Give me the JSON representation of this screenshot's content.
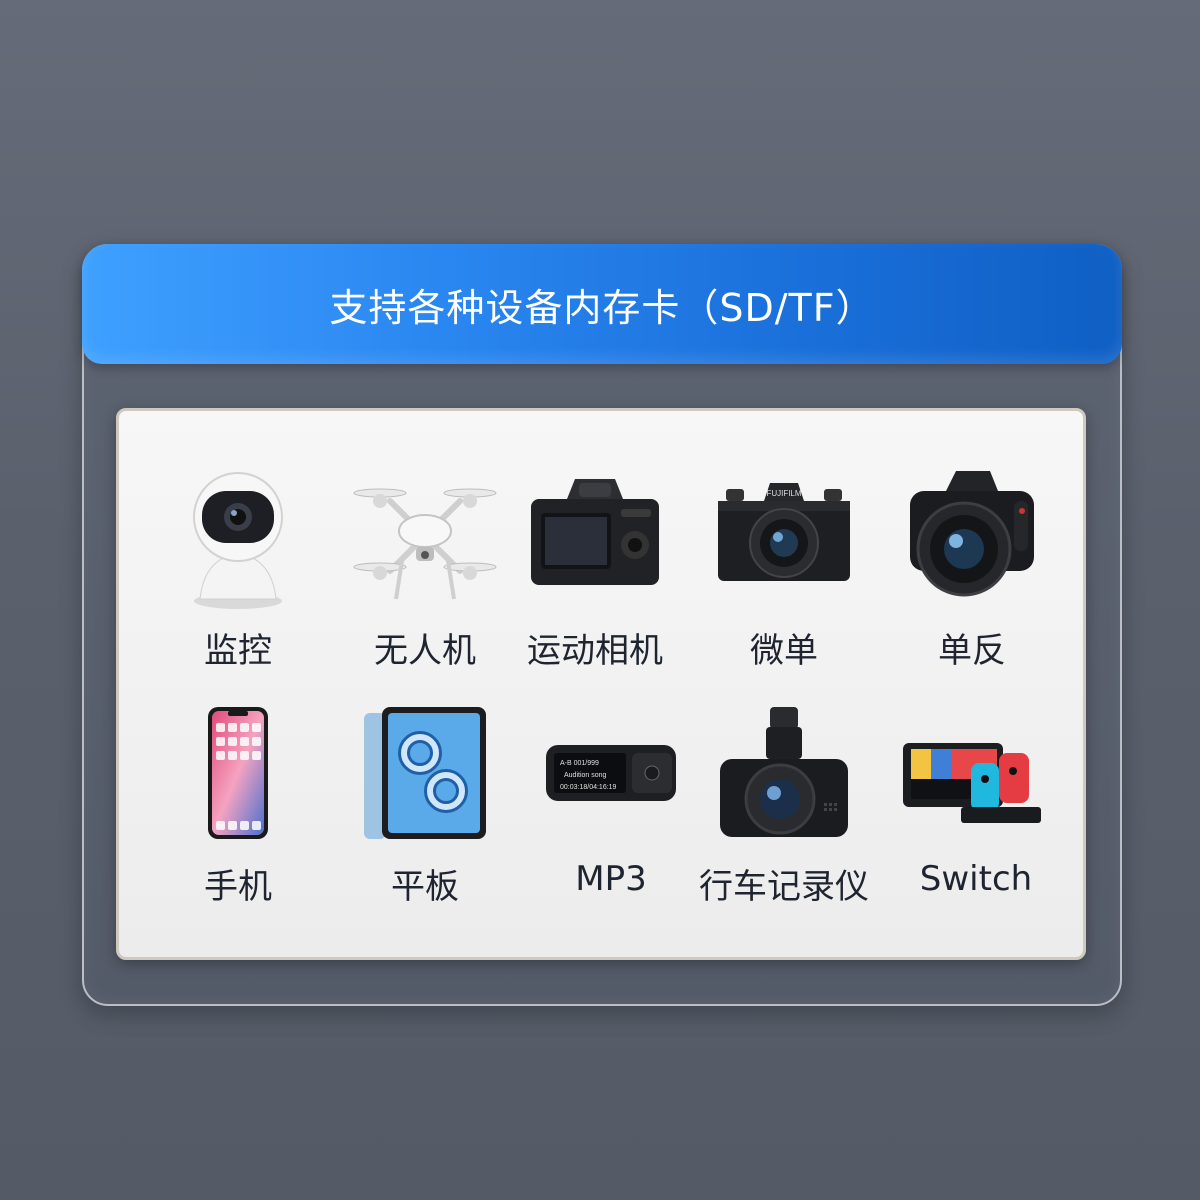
{
  "header": {
    "title": "支持各种设备内存卡（SD/TF）"
  },
  "devices": [
    {
      "label": "监控",
      "icon": "security-camera-icon"
    },
    {
      "label": "无人机",
      "icon": "drone-icon"
    },
    {
      "label": "运动相机",
      "icon": "action-camera-icon"
    },
    {
      "label": "微单",
      "icon": "mirrorless-camera-icon"
    },
    {
      "label": "单反",
      "icon": "dslr-camera-icon"
    },
    {
      "label": "手机",
      "icon": "smartphone-icon"
    },
    {
      "label": "平板",
      "icon": "tablet-icon"
    },
    {
      "label": "MP3",
      "icon": "mp3-player-icon"
    },
    {
      "label": "行车记录仪",
      "icon": "dashcam-icon"
    },
    {
      "label": "Switch",
      "icon": "game-console-icon"
    }
  ],
  "colors": {
    "banner_start": "#3ea0ff",
    "banner_end": "#0f5fc4",
    "background": "#5a606c",
    "card": "#f2f2f2",
    "label_text": "#1f2530"
  }
}
